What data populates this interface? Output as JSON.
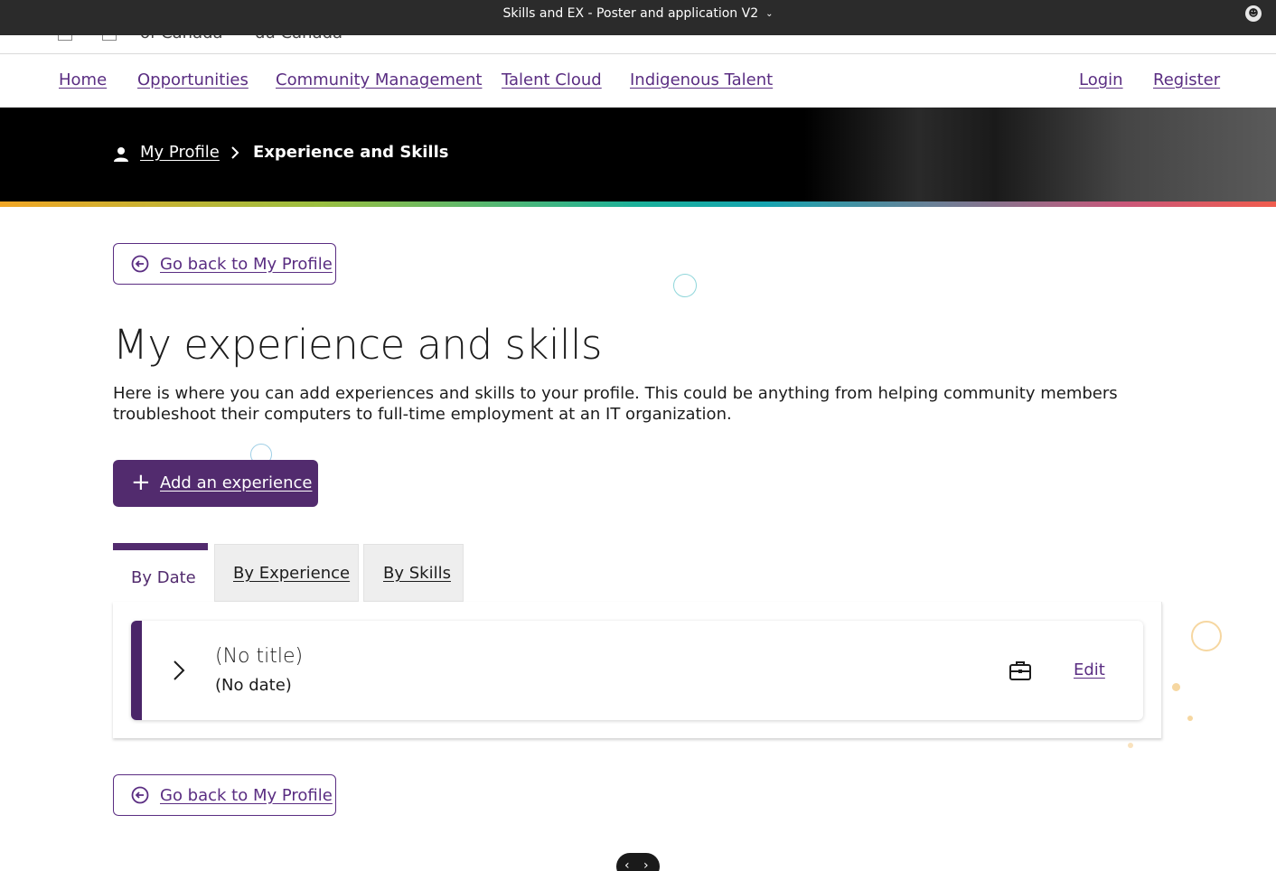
{
  "window": {
    "title": "Skills and EX - Poster and application V2"
  },
  "gov_header": {
    "left_text": "of Canada",
    "right_text": "du Canada"
  },
  "nav": {
    "items": [
      {
        "label": "Home"
      },
      {
        "label": "Opportunities"
      },
      {
        "label": "Community Management"
      },
      {
        "label": "Talent Cloud"
      },
      {
        "label": "Indigenous Talent"
      }
    ],
    "login": "Login",
    "register": "Register"
  },
  "breadcrumb": {
    "parent": "My Profile",
    "current": "Experience and Skills"
  },
  "back_button": {
    "label": "Go back to My Profile"
  },
  "page": {
    "title": "My experience and skills",
    "description": "Here is where you can add experiences and skills to your profile. This could be anything from helping community members troubleshoot their computers to full-time employment at an IT organization."
  },
  "add_button": {
    "label": "Add an experience"
  },
  "tabs": [
    {
      "label": "By Date",
      "active": true
    },
    {
      "label": "By Experience",
      "active": false
    },
    {
      "label": "By Skills",
      "active": false
    }
  ],
  "experience": {
    "title": "(No title)",
    "date": "(No date)",
    "icon": "briefcase-icon",
    "edit_label": "Edit"
  },
  "colors": {
    "brand_purple": "#522b6e",
    "link_purple": "#5a2d82"
  }
}
